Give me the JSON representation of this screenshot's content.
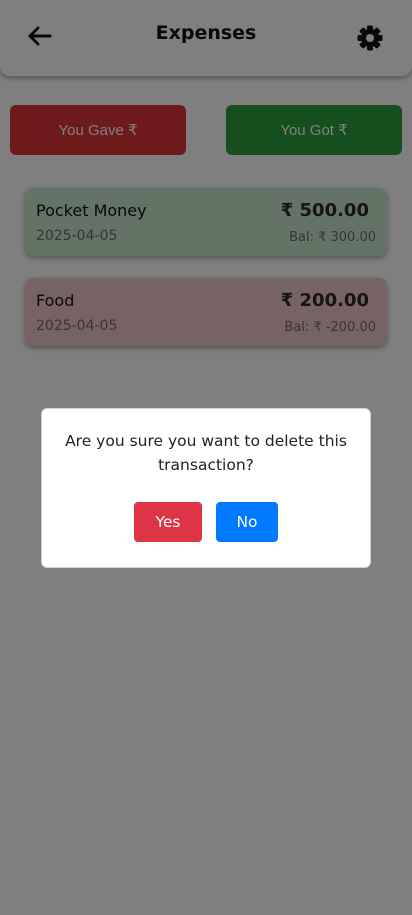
{
  "header": {
    "title": "Expenses",
    "back_icon": "arrow-left-icon",
    "settings_icon": "gear-icon"
  },
  "actions": {
    "gave_label": "You Gave ₹",
    "got_label": "You Got ₹"
  },
  "transactions": [
    {
      "name": "Pocket Money",
      "date": "2025-04-05",
      "amount": "₹ 500.00",
      "balance": "Bal: ₹ 300.00",
      "type": "income"
    },
    {
      "name": "Food",
      "date": "2025-04-05",
      "amount": "₹ 200.00",
      "balance": "Bal: ₹ -200.00",
      "type": "expense"
    }
  ],
  "dialog": {
    "message": "Are you sure you want to delete this transaction?",
    "yes_label": "Yes",
    "no_label": "No"
  },
  "colors": {
    "gave": "#dc3535",
    "got": "#2f9c3c",
    "income_card": "#c7e6cc",
    "expense_card": "#efc6c8",
    "yes": "#dc3545",
    "no": "#007bff"
  }
}
